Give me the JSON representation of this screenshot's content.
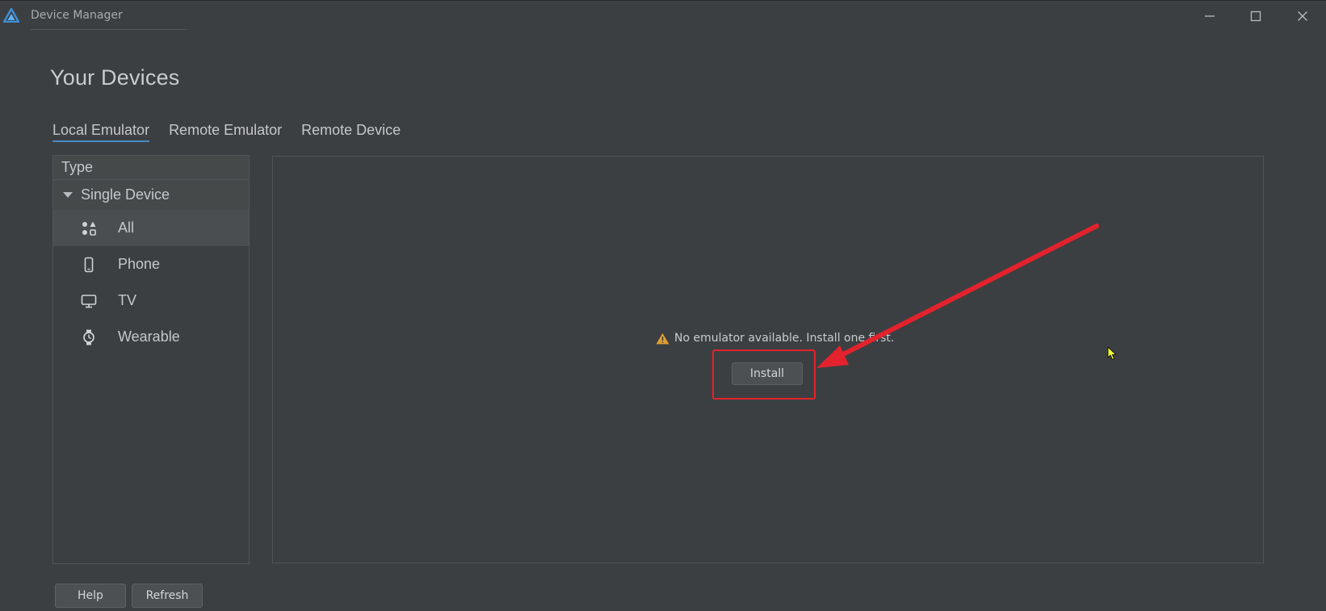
{
  "window": {
    "title": "Device Manager",
    "minimize_icon": "minimize-icon",
    "maximize_icon": "maximize-icon",
    "close_icon": "close-icon"
  },
  "page": {
    "title": "Your Devices"
  },
  "tabs": [
    {
      "label": "Local Emulator",
      "active": true
    },
    {
      "label": "Remote Emulator",
      "active": false
    },
    {
      "label": "Remote Device",
      "active": false
    }
  ],
  "sidebar": {
    "header": "Type",
    "group": {
      "label": "Single Device",
      "expanded": true
    },
    "items": [
      {
        "label": "All",
        "icon": "grid-icon",
        "selected": true
      },
      {
        "label": "Phone",
        "icon": "phone-icon",
        "selected": false
      },
      {
        "label": "TV",
        "icon": "tv-icon",
        "selected": false
      },
      {
        "label": "Wearable",
        "icon": "watch-icon",
        "selected": false
      }
    ]
  },
  "content": {
    "empty_message": "No emulator available. Install one first.",
    "warning_icon": "warning-icon",
    "install_label": "Install"
  },
  "annotation": {
    "highlight_color": "#e3222d"
  },
  "footer": {
    "help_label": "Help",
    "refresh_label": "Refresh"
  },
  "colors": {
    "background": "#3c3f41",
    "accent": "#4a88c7",
    "warning": "#e0a030"
  }
}
